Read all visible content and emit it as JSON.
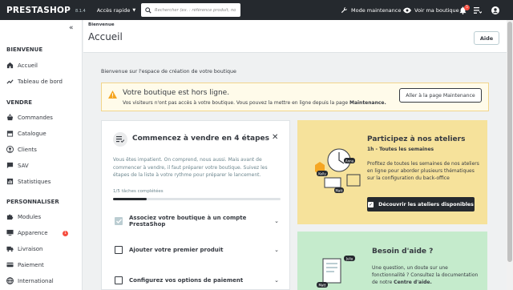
{
  "header": {
    "logo": "PRESTASHOP",
    "version": "8.1.4",
    "quick_access": "Accès rapide",
    "search_placeholder": "Rechercher (ex. : référence produit, no",
    "maintenance_mode": "Mode maintenance",
    "view_shop": "Voir ma boutique",
    "notifications_count": "5"
  },
  "sidebar": {
    "sections": [
      {
        "title": "BIENVENUE",
        "items": [
          {
            "label": "Accueil",
            "icon": "home-icon"
          },
          {
            "label": "Tableau de bord",
            "icon": "chart-icon"
          }
        ]
      },
      {
        "title": "VENDRE",
        "items": [
          {
            "label": "Commandes",
            "icon": "basket-icon"
          },
          {
            "label": "Catalogue",
            "icon": "store-icon"
          },
          {
            "label": "Clients",
            "icon": "user-icon"
          },
          {
            "label": "SAV",
            "icon": "chat-icon"
          },
          {
            "label": "Statistiques",
            "icon": "stats-icon"
          }
        ]
      },
      {
        "title": "PERSONNALISER",
        "items": [
          {
            "label": "Modules",
            "icon": "puzzle-icon"
          },
          {
            "label": "Apparence",
            "icon": "desktop-icon",
            "badge": "1"
          },
          {
            "label": "Livraison",
            "icon": "truck-icon"
          },
          {
            "label": "Paiement",
            "icon": "card-icon"
          },
          {
            "label": "International",
            "icon": "globe-icon"
          }
        ]
      }
    ]
  },
  "page": {
    "breadcrumb": "Bienvenue",
    "title": "Accueil",
    "help_button": "Aide",
    "welcome_text": "Bienvenue sur l'espace de création de votre boutique"
  },
  "alert": {
    "title": "Votre boutique est hors ligne.",
    "text": "Vos visiteurs n'ont pas accès à votre boutique. Vous pouvez la mettre en ligne depuis la page ",
    "text_bold": "Maintenance.",
    "button": "Aller à la page Maintenance"
  },
  "onboarding": {
    "title": "Commencez à vendre en 4 étapes",
    "description": "Vous êtes impatient. On comprend, nous aussi. Mais avant de commencer à vendre, il faut préparer votre boutique. Suivez les étapes de la liste à votre rythme pour préparer le lancement.",
    "progress_label": "1/5 tâches complétées",
    "progress_fraction": 0.2,
    "tasks": [
      {
        "label": "Associez votre boutique à un compte PrestaShop",
        "done": true
      },
      {
        "label": "Ajouter votre premier produit",
        "done": false
      },
      {
        "label": "Configurez vos options de paiement",
        "done": false
      }
    ]
  },
  "workshops": {
    "title": "Participez à nos ateliers",
    "subtitle": "1h - Toutes les semaines",
    "text": "Profitez de toutes les semaines de nos ateliers en ligne pour aborder plusieurs thématiques sur la configuration du back-office",
    "button": "Découvrir les ateliers disponibles",
    "tags": [
      "Anna",
      "Kelly",
      "Matt"
    ]
  },
  "help": {
    "title": "Besoin d'aide ?",
    "text": "Une question, un doute sur une fonctionnalité ? Consultez la documentation de notre ",
    "text_bold": "Centre d'aide.",
    "tags": [
      "Julia",
      "Matt"
    ]
  },
  "colors": {
    "header_bg": "#25292e",
    "alert_bg": "#fffbea",
    "workshop_bg": "#f6e29b",
    "help_bg": "#c5ebcc",
    "badge": "#f54c3e"
  }
}
